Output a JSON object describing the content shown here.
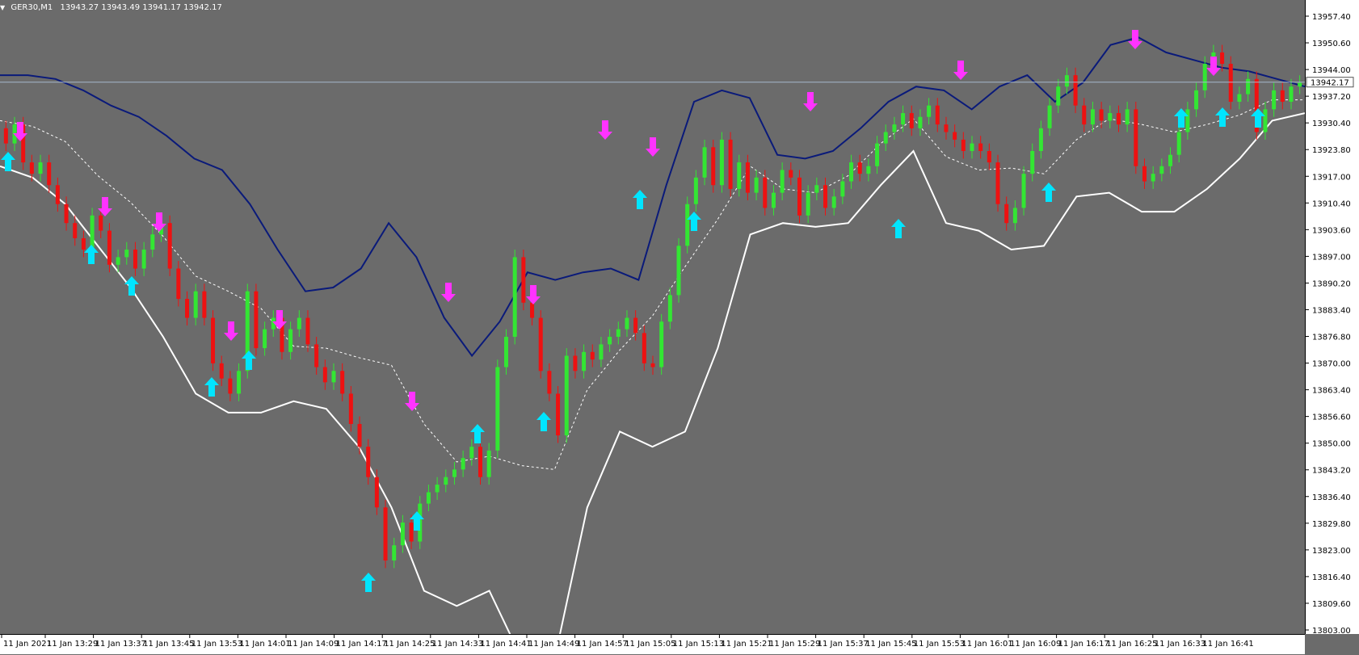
{
  "chart_header": {
    "menu_arrow": "▼",
    "symbol": "GER30,M1",
    "ohlc": "13943.27 13943.49 13941.17 13942.17"
  },
  "price_axis": {
    "labels": [
      "13957.40",
      "13950.60",
      "13944.00",
      "13937.20",
      "13930.40",
      "13923.80",
      "13917.00",
      "13910.40",
      "13903.60",
      "13897.00",
      "13890.20",
      "13883.40",
      "13876.80",
      "13870.00",
      "13863.40",
      "13856.60",
      "13850.00",
      "13843.20",
      "13836.40",
      "13829.80",
      "13823.00",
      "13816.40",
      "13809.60",
      "13803.00"
    ],
    "current_price": "13942.17"
  },
  "time_axis": {
    "labels": [
      "11 Jan 2021",
      "11 Jan 13:29",
      "11 Jan 13:37",
      "11 Jan 13:45",
      "11 Jan 13:53",
      "11 Jan 14:01",
      "11 Jan 14:09",
      "11 Jan 14:17",
      "11 Jan 14:25",
      "11 Jan 14:33",
      "11 Jan 14:41",
      "11 Jan 14:49",
      "11 Jan 14:57",
      "11 Jan 15:05",
      "11 Jan 15:13",
      "11 Jan 15:21",
      "11 Jan 15:29",
      "11 Jan 15:37",
      "11 Jan 15:45",
      "11 Jan 15:53",
      "11 Jan 16:01",
      "11 Jan 16:09",
      "11 Jan 16:17",
      "11 Jan 16:25",
      "11 Jan 16:33",
      "11 Jan 16:41"
    ]
  },
  "colors": {
    "background": "#6b6b6b",
    "bull": "#33e633",
    "bear": "#ee1111",
    "band_upper_dark": "#0a1a7a",
    "band_white": "#ffffff",
    "buy_arrow": "#00e5ff",
    "sell_arrow": "#ff33ff"
  },
  "chart_data": {
    "type": "candlestick",
    "symbol": "GER30",
    "timeframe": "M1",
    "ylim": [
      13803.0,
      13960.0
    ],
    "candles_open_close_approx": [
      [
        13930,
        13926
      ],
      [
        13926,
        13931
      ],
      [
        13931,
        13921
      ],
      [
        13921,
        13918
      ],
      [
        13918,
        13921
      ],
      [
        13921,
        13915
      ],
      [
        13915,
        13910
      ],
      [
        13910,
        13905
      ],
      [
        13905,
        13901
      ],
      [
        13901,
        13898
      ],
      [
        13898,
        13907
      ],
      [
        13907,
        13903
      ],
      [
        13903,
        13894
      ],
      [
        13894,
        13896
      ],
      [
        13896,
        13898
      ],
      [
        13898,
        13893
      ],
      [
        13893,
        13898
      ],
      [
        13898,
        13902
      ],
      [
        13902,
        13905
      ],
      [
        13905,
        13893
      ],
      [
        13893,
        13885
      ],
      [
        13885,
        13880
      ],
      [
        13880,
        13887
      ],
      [
        13887,
        13880
      ],
      [
        13880,
        13868
      ],
      [
        13868,
        13864
      ],
      [
        13864,
        13860
      ],
      [
        13860,
        13866
      ],
      [
        13866,
        13887
      ],
      [
        13887,
        13872
      ],
      [
        13872,
        13877
      ],
      [
        13877,
        13880
      ],
      [
        13880,
        13871
      ],
      [
        13871,
        13877
      ],
      [
        13877,
        13880
      ],
      [
        13880,
        13873
      ],
      [
        13873,
        13867
      ],
      [
        13867,
        13863
      ],
      [
        13863,
        13866
      ],
      [
        13866,
        13860
      ],
      [
        13860,
        13852
      ],
      [
        13852,
        13846
      ],
      [
        13846,
        13838
      ],
      [
        13838,
        13830
      ],
      [
        13830,
        13816
      ],
      [
        13816,
        13820
      ],
      [
        13820,
        13826
      ],
      [
        13826,
        13821
      ],
      [
        13821,
        13831
      ],
      [
        13831,
        13834
      ],
      [
        13834,
        13836
      ],
      [
        13836,
        13838
      ],
      [
        13838,
        13840
      ],
      [
        13840,
        13843
      ],
      [
        13843,
        13846
      ],
      [
        13846,
        13838
      ],
      [
        13838,
        13845
      ],
      [
        13845,
        13867
      ],
      [
        13867,
        13875
      ],
      [
        13875,
        13896
      ],
      [
        13896,
        13884
      ],
      [
        13884,
        13880
      ],
      [
        13880,
        13866
      ],
      [
        13866,
        13860
      ],
      [
        13860,
        13849
      ],
      [
        13849,
        13870
      ],
      [
        13870,
        13866
      ],
      [
        13866,
        13871
      ],
      [
        13871,
        13869
      ],
      [
        13869,
        13873
      ],
      [
        13873,
        13875
      ],
      [
        13875,
        13877
      ],
      [
        13877,
        13880
      ],
      [
        13880,
        13876
      ],
      [
        13876,
        13868
      ],
      [
        13868,
        13867
      ],
      [
        13867,
        13879
      ],
      [
        13879,
        13886
      ],
      [
        13886,
        13899
      ],
      [
        13899,
        13910
      ],
      [
        13910,
        13917
      ],
      [
        13917,
        13925
      ],
      [
        13925,
        13915
      ],
      [
        13915,
        13927
      ],
      [
        13927,
        13914
      ],
      [
        13914,
        13921
      ],
      [
        13921,
        13913
      ],
      [
        13913,
        13917
      ],
      [
        13917,
        13909
      ],
      [
        13909,
        13913
      ],
      [
        13913,
        13919
      ],
      [
        13919,
        13917
      ],
      [
        13917,
        13907
      ],
      [
        13907,
        13913
      ],
      [
        13913,
        13915
      ],
      [
        13915,
        13909
      ],
      [
        13909,
        13912
      ],
      [
        13912,
        13916
      ],
      [
        13916,
        13921
      ],
      [
        13921,
        13918
      ],
      [
        13918,
        13920
      ],
      [
        13920,
        13926
      ],
      [
        13926,
        13929
      ],
      [
        13929,
        13931
      ],
      [
        13931,
        13934
      ],
      [
        13934,
        13930
      ],
      [
        13930,
        13933
      ],
      [
        13933,
        13936
      ],
      [
        13936,
        13931
      ],
      [
        13931,
        13929
      ],
      [
        13929,
        13927
      ],
      [
        13927,
        13924
      ],
      [
        13924,
        13926
      ],
      [
        13926,
        13924
      ],
      [
        13924,
        13921
      ],
      [
        13921,
        13910
      ],
      [
        13910,
        13905
      ],
      [
        13905,
        13909
      ],
      [
        13909,
        13918
      ],
      [
        13918,
        13924
      ],
      [
        13924,
        13930
      ],
      [
        13930,
        13936
      ],
      [
        13936,
        13941
      ],
      [
        13941,
        13944
      ],
      [
        13944,
        13936
      ],
      [
        13936,
        13931
      ],
      [
        13931,
        13935
      ],
      [
        13935,
        13932
      ],
      [
        13932,
        13934
      ],
      [
        13934,
        13931
      ],
      [
        13931,
        13935
      ],
      [
        13935,
        13920
      ],
      [
        13920,
        13916
      ],
      [
        13916,
        13918
      ],
      [
        13918,
        13920
      ],
      [
        13920,
        13923
      ],
      [
        13923,
        13929
      ],
      [
        13929,
        13935
      ],
      [
        13935,
        13940
      ],
      [
        13940,
        13947
      ],
      [
        13947,
        13950
      ],
      [
        13950,
        13947
      ],
      [
        13947,
        13937
      ],
      [
        13937,
        13939
      ],
      [
        13939,
        13943
      ],
      [
        13943,
        13929
      ],
      [
        13929,
        13935
      ],
      [
        13935,
        13940
      ],
      [
        13940,
        13937
      ],
      [
        13937,
        13941
      ],
      [
        13941,
        13942
      ]
    ],
    "upper_band_approx": [
      13944,
      13944,
      13943,
      13940,
      13936,
      13933,
      13928,
      13922,
      13919,
      13910,
      13898,
      13887,
      13888,
      13893,
      13905,
      13896,
      13880,
      13870,
      13879,
      13892,
      13890,
      13892,
      13893,
      13890,
      13915,
      13937,
      13940,
      13938,
      13923,
      13922,
      13924,
      13930,
      13937,
      13941,
      13940,
      13935,
      13941,
      13944,
      13937,
      13942,
      13952,
      13954,
      13950,
      13948,
      13946,
      13945,
      13943,
      13941
    ],
    "lower_band_approx": [
      13920,
      13917,
      13910,
      13899,
      13888,
      13875,
      13860,
      13855,
      13855,
      13858,
      13856,
      13846,
      13830,
      13808,
      13804,
      13808,
      13790,
      13790,
      13830,
      13850,
      13846,
      13850,
      13872,
      13902,
      13905,
      13904,
      13905,
      13915,
      13924,
      13905,
      13903,
      13898,
      13899,
      13912,
      13913,
      13908,
      13908,
      13914,
      13922,
      13932,
      13934
    ],
    "buy_signals": 19,
    "sell_signals": 15
  }
}
